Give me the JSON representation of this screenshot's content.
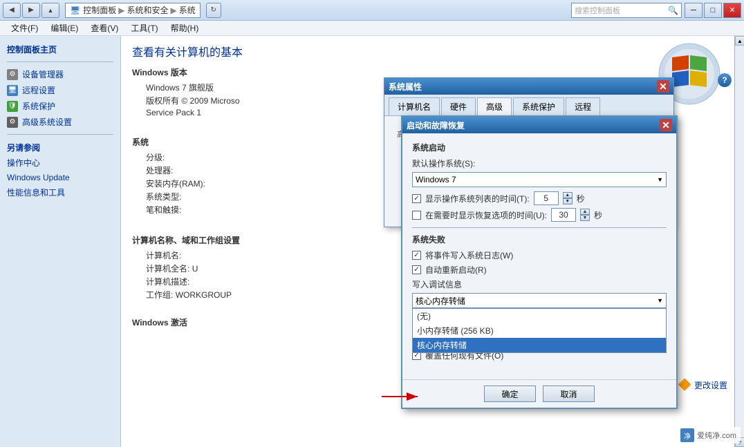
{
  "titlebar": {
    "address_parts": [
      "控制面板",
      "系统和安全",
      "系统"
    ],
    "search_placeholder": "搜索控制面板",
    "controls": [
      "─",
      "□",
      "✕"
    ]
  },
  "menubar": {
    "items": [
      "文件(F)",
      "编辑(E)",
      "查看(V)",
      "工具(T)",
      "帮助(H)"
    ]
  },
  "sidebar": {
    "main_link": "控制面板主页",
    "items": [
      {
        "label": "设备管理器",
        "icon": "gear"
      },
      {
        "label": "远程设置",
        "icon": "monitor"
      },
      {
        "label": "系统保护",
        "icon": "shield"
      },
      {
        "label": "高级系统设置",
        "icon": "settings"
      }
    ],
    "also_section": "另请参阅",
    "also_items": [
      "操作中心",
      "Windows Update",
      "性能信息和工具"
    ]
  },
  "content": {
    "title": "查看有关计算机的基本",
    "win_version_section": "Windows 版本",
    "win_version_name": "Windows 7 旗舰版",
    "win_copyright": "版权所有 © 2009 Microso",
    "service_pack": "Service Pack 1",
    "system_section": "系统",
    "system_items": [
      {
        "label": "分级:"
      },
      {
        "label": "处理器:"
      },
      {
        "label": "安装内存(RAM):"
      },
      {
        "label": "系统类型:"
      },
      {
        "label": "笔和触摸:"
      }
    ],
    "computer_section": "计算机名称、域和工作组设置",
    "computer_items": [
      {
        "label": "计算机名:"
      },
      {
        "label": "计算机全名:",
        "value": "U"
      },
      {
        "label": "计算机描述:"
      },
      {
        "label": "工作组:",
        "value": "WORKGROUP"
      }
    ],
    "activation_section": "Windows 激活",
    "more_settings": "更改设置"
  },
  "system_props_dialog": {
    "title": "系统属性",
    "close": "✕",
    "tabs": [
      "计算机名",
      "硬件",
      "高级",
      "系统保护",
      "远程"
    ],
    "active_tab": "高级"
  },
  "startup_dialog": {
    "title": "启动和故障恢复",
    "close": "✕",
    "system_startup_label": "系统启动",
    "default_os_label": "默认操作系统(S):",
    "default_os_value": "Windows 7",
    "show_time_label": "显示操作系统列表的时间(T):",
    "show_time_checked": true,
    "show_time_value": "5",
    "show_time_unit": "秒",
    "recovery_time_label": "在需要时显示恢复选项的时间(U):",
    "recovery_time_checked": false,
    "recovery_time_value": "30",
    "recovery_time_unit": "秒",
    "failure_section": "系统失败",
    "write_event_label": "将事件写入系统日志(W)",
    "write_event_checked": true,
    "auto_restart_label": "自动重新启动(R)",
    "auto_restart_checked": true,
    "debug_info_label": "写入调试信息",
    "debug_dropdown": {
      "selected": "核心内存转储",
      "options": [
        "(无)",
        "小内存转储 (256 KB)",
        "核心内存转储"
      ]
    },
    "overwrite_label": "覆盖任何现有文件(O)",
    "overwrite_checked": true,
    "btn_ok": "确定",
    "btn_cancel": "取消"
  }
}
